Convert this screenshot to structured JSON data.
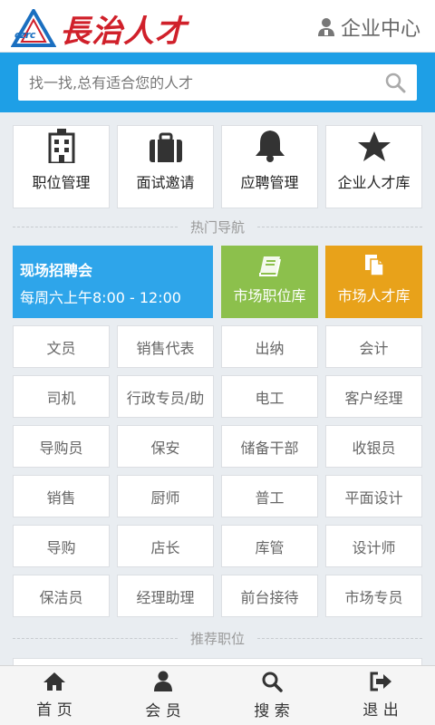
{
  "header": {
    "logo_mark_text": "czrc",
    "logo_name": "長治人才",
    "corp_center_label": "企业中心"
  },
  "search": {
    "placeholder": "找一找,总有适合您的人才"
  },
  "quick_actions": [
    {
      "label": "职位管理",
      "icon": "building-icon"
    },
    {
      "label": "面试邀请",
      "icon": "briefcase-icon"
    },
    {
      "label": "应聘管理",
      "icon": "bell-icon"
    },
    {
      "label": "企业人才库",
      "icon": "star-icon"
    }
  ],
  "sections": {
    "hot_nav": "热门导航",
    "recommended": "推荐职位"
  },
  "job_fair": {
    "title": "现场招聘会",
    "schedule": "每周六上午8:00 - 12:00"
  },
  "tiles": [
    {
      "label": "市场职位库",
      "icon": "book-icon",
      "color": "#8cc04c"
    },
    {
      "label": "市场人才库",
      "icon": "documents-icon",
      "color": "#e8a21a"
    }
  ],
  "jobs": [
    "文员",
    "销售代表",
    "出纳",
    "会计",
    "司机",
    "行政专员/助",
    "电工",
    "客户经理",
    "导购员",
    "保安",
    "储备干部",
    "收银员",
    "销售",
    "厨师",
    "普工",
    "平面设计",
    "导购",
    "店长",
    "库管",
    "设计师",
    "保洁员",
    "经理助理",
    "前台接待",
    "市场专员"
  ],
  "tabbar": [
    {
      "label": "首 页",
      "icon": "home-icon"
    },
    {
      "label": "会 员",
      "icon": "user-icon"
    },
    {
      "label": "搜 索",
      "icon": "search-icon"
    },
    {
      "label": "退 出",
      "icon": "logout-icon"
    }
  ],
  "colors": {
    "accent_blue": "#1e9fe6",
    "brand_red": "#d0202a",
    "green_tile": "#8cc04c",
    "orange_tile": "#e8a21a"
  }
}
